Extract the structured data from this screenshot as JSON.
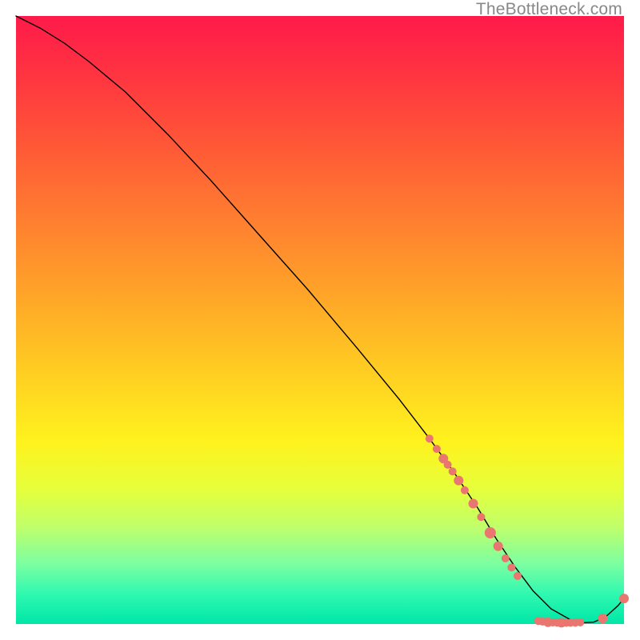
{
  "watermark": "TheBottleneck.com",
  "chart_data": {
    "type": "line",
    "title": "",
    "xlabel": "",
    "ylabel": "",
    "xlim": [
      0,
      100
    ],
    "ylim": [
      0,
      100
    ],
    "grid": false,
    "background": "rainbow-gradient-vertical",
    "series": [
      {
        "name": "bottleneck-curve",
        "x": [
          0,
          4,
          8,
          12,
          18,
          25,
          32,
          40,
          48,
          56,
          63,
          68,
          72,
          76,
          79,
          82,
          85,
          88,
          91,
          93,
          95,
          97,
          99,
          100
        ],
        "y": [
          100,
          98.0,
          95.5,
          92.5,
          87.5,
          80.5,
          73.0,
          64.0,
          55.0,
          45.5,
          37.0,
          30.5,
          25.0,
          19.0,
          14.0,
          9.5,
          5.5,
          2.5,
          0.8,
          0.2,
          0.3,
          1.2,
          3.0,
          4.2
        ]
      }
    ],
    "scatter_points": {
      "name": "markers",
      "color": "#e9766f",
      "points": [
        {
          "x": 68.0,
          "y": 30.5,
          "r": 5
        },
        {
          "x": 69.2,
          "y": 28.8,
          "r": 5
        },
        {
          "x": 70.3,
          "y": 27.2,
          "r": 6
        },
        {
          "x": 71.0,
          "y": 26.2,
          "r": 5
        },
        {
          "x": 71.8,
          "y": 25.1,
          "r": 5
        },
        {
          "x": 72.8,
          "y": 23.6,
          "r": 6
        },
        {
          "x": 73.8,
          "y": 22.0,
          "r": 5
        },
        {
          "x": 75.2,
          "y": 19.8,
          "r": 6
        },
        {
          "x": 76.5,
          "y": 17.6,
          "r": 5
        },
        {
          "x": 78.0,
          "y": 15.0,
          "r": 7
        },
        {
          "x": 79.3,
          "y": 12.8,
          "r": 6
        },
        {
          "x": 80.5,
          "y": 10.8,
          "r": 5
        },
        {
          "x": 81.5,
          "y": 9.3,
          "r": 5
        },
        {
          "x": 82.5,
          "y": 7.9,
          "r": 5
        },
        {
          "x": 85.9,
          "y": 0.5,
          "r": 5
        },
        {
          "x": 86.6,
          "y": 0.4,
          "r": 5
        },
        {
          "x": 87.5,
          "y": 0.3,
          "r": 6
        },
        {
          "x": 88.3,
          "y": 0.25,
          "r": 5
        },
        {
          "x": 89.0,
          "y": 0.22,
          "r": 5
        },
        {
          "x": 89.7,
          "y": 0.21,
          "r": 6
        },
        {
          "x": 90.5,
          "y": 0.2,
          "r": 5
        },
        {
          "x": 91.2,
          "y": 0.2,
          "r": 5
        },
        {
          "x": 92.0,
          "y": 0.22,
          "r": 5
        },
        {
          "x": 92.8,
          "y": 0.27,
          "r": 5
        },
        {
          "x": 96.5,
          "y": 0.9,
          "r": 6
        },
        {
          "x": 100.0,
          "y": 4.2,
          "r": 6
        }
      ]
    }
  }
}
